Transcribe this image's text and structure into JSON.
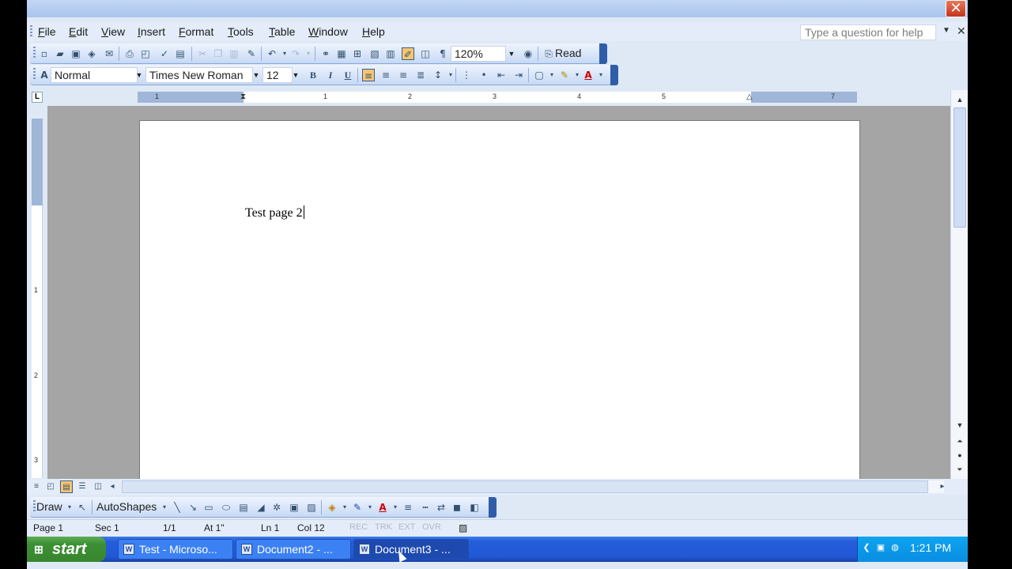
{
  "window": {
    "close_glyph": "✕"
  },
  "menu": {
    "items": [
      {
        "label": "File",
        "key": "F",
        "rest": "ile"
      },
      {
        "label": "Edit",
        "key": "E",
        "rest": "dit"
      },
      {
        "label": "View",
        "key": "V",
        "rest": "iew"
      },
      {
        "label": "Insert",
        "key": "I",
        "rest": "nsert"
      },
      {
        "label": "Format",
        "key": "F",
        "rest": "ormat"
      },
      {
        "label": "Tools",
        "key": "T",
        "rest": "ools"
      },
      {
        "label": "Table",
        "key": "T",
        "rest": "able"
      },
      {
        "label": "Window",
        "key": "W",
        "rest": "indow"
      },
      {
        "label": "Help",
        "key": "H",
        "rest": "elp"
      }
    ],
    "help_placeholder": "Type a question for help"
  },
  "standard_toolbar": {
    "zoom": "120%",
    "read_label": "Read"
  },
  "format_toolbar": {
    "style": "Normal",
    "font": "Times New Roman",
    "size": "12",
    "bold": "B",
    "italic": "I",
    "underline": "U"
  },
  "ruler": {
    "numbers": [
      "1",
      "1",
      "2",
      "3",
      "4",
      "5",
      "7"
    ]
  },
  "vruler": {
    "numbers": [
      "1",
      "2",
      "3"
    ]
  },
  "document": {
    "text": "Test page 2"
  },
  "draw_toolbar": {
    "draw_label": "Draw",
    "autoshapes_label": "AutoShapes"
  },
  "status": {
    "page": "Page 1",
    "sec": "Sec 1",
    "pages": "1/1",
    "at": "At 1\"",
    "ln": "Ln 1",
    "col": "Col 12",
    "rec": "REC",
    "trk": "TRK",
    "ext": "EXT",
    "ovr": "OVR"
  },
  "taskbar": {
    "start_label": "start",
    "tasks": [
      {
        "label": "Test - Microso..."
      },
      {
        "label": "Document2 - ..."
      },
      {
        "label": "Document3 - ..."
      }
    ],
    "clock": "1:21 PM"
  },
  "colors": {
    "taskbar": "#245edb",
    "start": "#3c8f34",
    "tray": "#0ea4f0"
  }
}
